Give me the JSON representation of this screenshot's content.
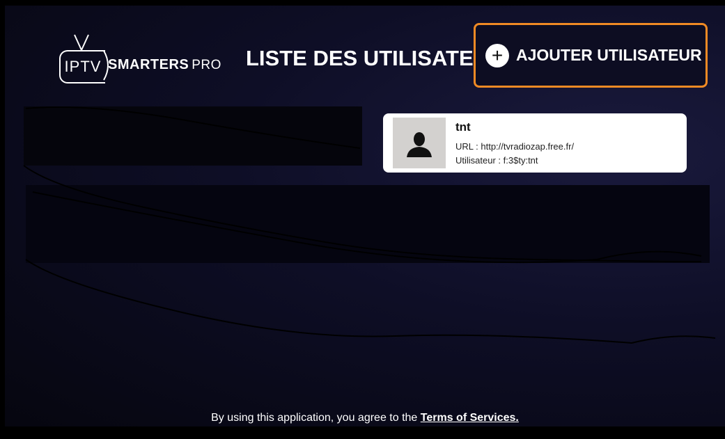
{
  "logo": {
    "iptv": "IPTV",
    "smarters": "SMARTERS",
    "pro": "PRO"
  },
  "header": {
    "title": "LISTE DES UTILISATEU",
    "add_user_label": "AJOUTER UTILISATEUR"
  },
  "users": [
    {
      "name": "tnt",
      "url_label": "URL :",
      "url": "http://tvradiozap.free.fr/",
      "user_label": "Utilisateur :",
      "user": "f:3$ty:tnt"
    }
  ],
  "footer": {
    "text": "By using this application, you agree to the",
    "terms": "Terms of Services."
  },
  "colors": {
    "accent": "#f08a24",
    "card": "#ffffff",
    "avatar_bg": "#d3d1cf"
  }
}
